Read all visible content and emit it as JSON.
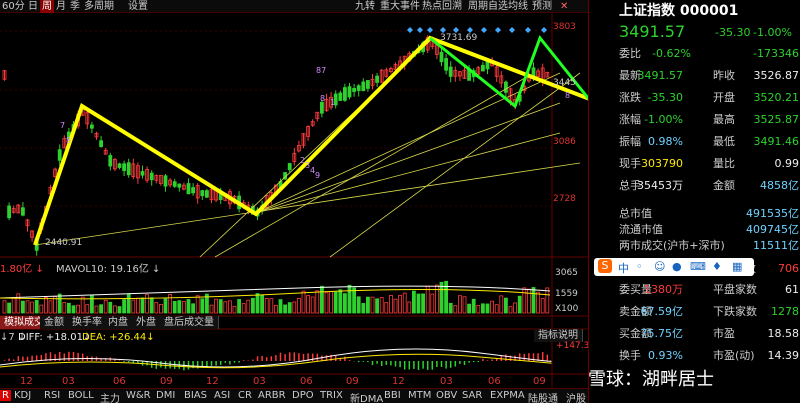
{
  "toolbar": {
    "items": [
      "60分",
      "日",
      "周",
      "月",
      "季",
      "多周期",
      "设置"
    ],
    "active_index": 2,
    "right_items": [
      "九转",
      "重大事件",
      "热点回溯",
      "周期自选",
      "均线",
      "预测"
    ]
  },
  "chart": {
    "price_labels": [
      "3803",
      "3445",
      "3086",
      "2728"
    ],
    "annotations": {
      "low_price": "2440.91",
      "high_price": "3731.69",
      "markers": [
        "7",
        "8",
        "87",
        "8",
        "1",
        "2",
        "3",
        "4",
        "9",
        "8"
      ]
    }
  },
  "volume_panel": {
    "label_prefix": "1.80亿 ↓",
    "mavol_label": "MAVOL10: 19.16亿 ↓",
    "axis_labels": [
      "3065",
      "1559",
      "X100"
    ]
  },
  "indicator_tabs": [
    "模拟成交量",
    "金额",
    "换手率",
    "内盘",
    "外盘",
    "盘后成交量"
  ],
  "macd_panel": {
    "diff_label": "DIFF: +18.01↓",
    "dea_label": "DEA: +26.44↓",
    "prefix": "↓7 ↓",
    "axis_label": "+147.3",
    "help_button": "指标说明"
  },
  "x_axis_ticks": [
    "12",
    "03",
    "06",
    "09",
    "12",
    "03",
    "06",
    "09",
    "12",
    "03",
    "06",
    "09"
  ],
  "bottom_tabs": [
    "KDJ",
    "RSI",
    "BOLL",
    "主力",
    "W&R",
    "DMI",
    "BIAS",
    "ASI",
    "CR",
    "ARBR",
    "DPO",
    "TRIX",
    "新DMA",
    "BBI",
    "MTM",
    "OBV",
    "SAR",
    "EXPMA",
    "陆股通",
    "沪股"
  ],
  "bottom_prefix": "R",
  "index_panel": {
    "title": "上证指数 000001",
    "price": "3491.57",
    "change": "-35.30",
    "change_pct": "-1.00%",
    "wei_bi_label": "委比",
    "wei_bi": "-0.62%",
    "wei_cha": "-173346",
    "rows": [
      {
        "l1": "最新",
        "v1": "3491.57",
        "l2": "昨收",
        "v2": "3526.87",
        "c1": "green",
        "c2": "white"
      },
      {
        "l1": "涨跌",
        "v1": "-35.30",
        "l2": "开盘",
        "v2": "3520.21",
        "c1": "green",
        "c2": "green"
      },
      {
        "l1": "涨幅",
        "v1": "-1.00%",
        "l2": "最高",
        "v2": "3525.87",
        "c1": "green",
        "c2": "green"
      },
      {
        "l1": "振幅",
        "v1": "0.98%",
        "l2": "最低",
        "v2": "3491.46",
        "c1": "cyan",
        "c2": "green"
      },
      {
        "l1": "现手",
        "v1": "303790",
        "l2": "量比",
        "v2": "0.99",
        "c1": "yellow",
        "c2": "white"
      },
      {
        "l1": "总手",
        "v1": "35453万",
        "l2": "金额",
        "v2": "4858亿",
        "c1": "white",
        "c2": "cyan"
      }
    ],
    "rows2": [
      {
        "label": "总市值",
        "value": "491535亿"
      },
      {
        "label": "流通市值",
        "value": "409745亿"
      },
      {
        "label": "两市成交(沪市+深市)",
        "value": "11511亿"
      }
    ],
    "rows3": [
      {
        "l1": "委买量",
        "v1": "1380万",
        "l2": "平盘家数",
        "v2": "61",
        "c1": "red",
        "c2": "white"
      },
      {
        "l1": "卖金额",
        "v1": "67.59亿",
        "l2": "下跌家数",
        "v2": "1278",
        "c1": "cyan",
        "c2": "green"
      },
      {
        "l1": "买金额",
        "v1": "75.75亿",
        "l2": "市盈",
        "v2": "18.58",
        "c1": "cyan",
        "c2": "white"
      },
      {
        "l1": "换手",
        "v1": "0.93%",
        "l2": "市盈(动)",
        "v2": "14.39",
        "c1": "cyan",
        "c2": "white"
      }
    ],
    "shu_label": "数",
    "shu_value": "706"
  },
  "watermark": "雪球：湖畔居士",
  "colors": {
    "up": "#ff3b3b",
    "down": "#2ed12e",
    "trend_yellow": "#ffff00",
    "trend_green": "#22ff22"
  }
}
